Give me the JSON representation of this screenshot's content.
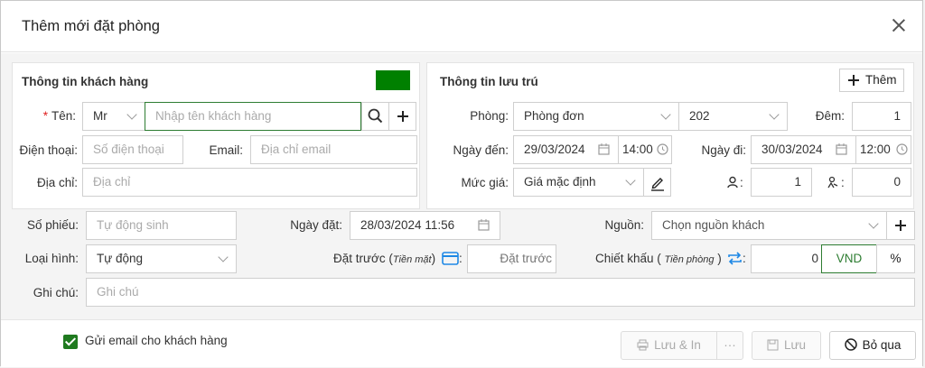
{
  "dialog": {
    "title": "Thêm mới đặt phòng"
  },
  "customer": {
    "section_title": "Thông tin khách hàng",
    "name_label": "Tên:",
    "required_mark": "*",
    "salutation": "Mr",
    "name_placeholder": "Nhập tên khách hàng",
    "phone_label": "Điện thoại:",
    "phone_placeholder": "Số điện thoại",
    "email_label": "Email:",
    "email_placeholder": "Địa chỉ email",
    "address_label": "Địa chỉ:",
    "address_placeholder": "Địa chỉ"
  },
  "stay": {
    "section_title": "Thông tin lưu trú",
    "add_label": "Thêm",
    "room_label": "Phòng:",
    "room_type": "Phòng đơn",
    "room_number": "202",
    "nights_label": "Đêm:",
    "nights": "1",
    "checkin_label": "Ngày đến:",
    "checkin_date": "29/03/2024",
    "checkin_time": "14:00",
    "checkout_label": "Ngày đi:",
    "checkout_date": "30/03/2024",
    "checkout_time": "12:00",
    "rate_label": "Mức giá:",
    "rate": "Giá mặc định",
    "adults": "1",
    "children": "0",
    "colon": ":"
  },
  "booking": {
    "ticket_label": "Số phiếu:",
    "ticket_placeholder": "Tự động sinh",
    "date_label": "Ngày đặt:",
    "date": "28/03/2024 11:56",
    "source_label": "Nguồn:",
    "source_placeholder": "Chọn nguồn khách",
    "type_label": "Loại hình:",
    "type_value": "Tự động",
    "deposit_label": "Đặt trước",
    "deposit_note": "Tiền mặt",
    "deposit_placeholder": "Đặt trước",
    "discount_label": "Chiết khấu",
    "discount_note": "Tiền phòng",
    "discount_value": "0",
    "currency": "VND",
    "percent": "%",
    "note_label": "Ghi chú:",
    "note_placeholder": "Ghi chú"
  },
  "footer": {
    "send_email_label": "Gửi email cho khách hàng",
    "save_print": "Lưu & In",
    "more": "···",
    "save": "Lưu",
    "skip": "Bỏ qua"
  },
  "colors": {
    "accent": "#008000",
    "checkbox": "#1f7a1f",
    "icon_blue": "#1e88e5"
  }
}
